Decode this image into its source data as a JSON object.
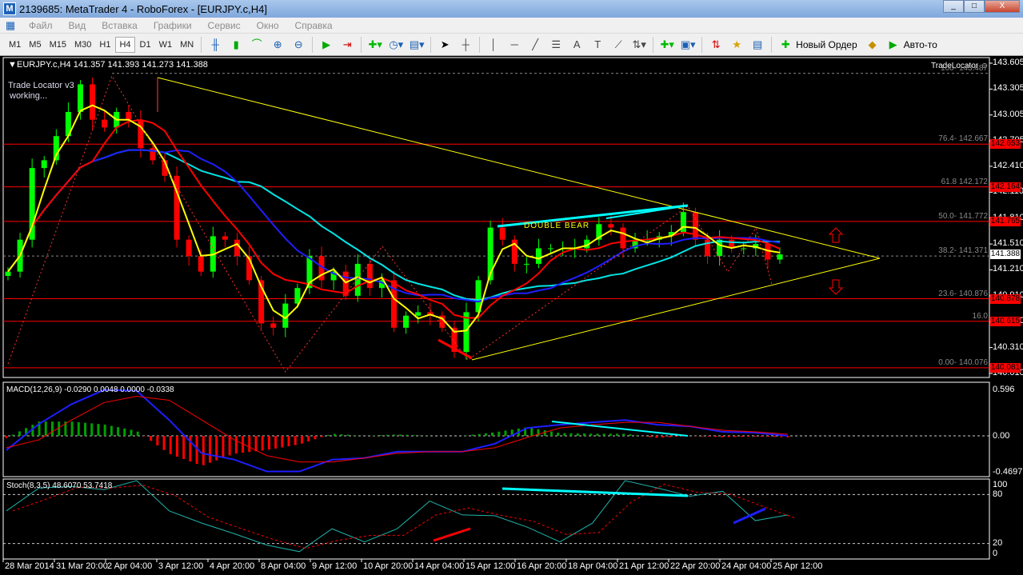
{
  "window": {
    "title": "2139685: MetaTrader 4 - RoboForex - [EURJPY.c,H4]",
    "app_icon": "mt4-logo-icon",
    "min": "_",
    "max": "□",
    "close": "X"
  },
  "menu": [
    "Файл",
    "Вид",
    "Вставка",
    "Графики",
    "Сервис",
    "Окно",
    "Справка"
  ],
  "toolbar": {
    "timeframes": [
      "M1",
      "M5",
      "M15",
      "M30",
      "H1",
      "H4",
      "D1",
      "W1",
      "MN"
    ],
    "active_timeframe": "H4",
    "new_order": "Новый Ордер",
    "autotrading": "Авто-то"
  },
  "chart": {
    "header": "EURJPY.c,H4  141.357 141.393 141.273 141.388",
    "indicator_name": "Trade Locator v3",
    "indicator_status": "working...",
    "tradelocator_label": "TradeLocator ☺",
    "annotation": "DOUBLE BEAR",
    "current_price": "141.388",
    "price_axis": [
      "143.605",
      "143.305",
      "143.005",
      "142.705",
      "142.410",
      "142.110",
      "141.810",
      "141.510",
      "141.210",
      "140.910",
      "140.610",
      "140.310",
      "140.010"
    ],
    "fib_levels": [
      {
        "label": "100- 143.487",
        "price": 143.487,
        "style": "dashed"
      },
      {
        "label": "76.4- 142.667",
        "price": 142.667,
        "style": "red",
        "tag": "142.653"
      },
      {
        "label": "61.8 142.172",
        "price": 142.172,
        "style": "red",
        "tag": "142.164"
      },
      {
        "label": "50.0- 141.772",
        "price": 141.772,
        "style": "red",
        "tag": "141.765"
      },
      {
        "label": "38.2- 141.371",
        "price": 141.371,
        "style": "dashed"
      },
      {
        "label": "23.6- 140.876",
        "price": 140.876,
        "style": "red",
        "tag": "140.878"
      },
      {
        "label": "16.0",
        "price": 140.615,
        "style": "red",
        "tag": "140.615"
      },
      {
        "label": "0.00- 140.076",
        "price": 140.076,
        "style": "red",
        "tag": "140.081"
      }
    ],
    "colors": {
      "bull": "#00ff00",
      "bear": "#ff0000",
      "ma_fast": "#ffff00",
      "ma_mid": "#ff0000",
      "ma_slow": "#1e1eff",
      "ma_long": "#00e5e5",
      "trend": "#ffff00"
    }
  },
  "macd": {
    "label": "MACD(12,26,9) -0.0290 0.0048 0.0000 -0.0338",
    "axis": [
      "0.596",
      "0.00",
      "-0.4697"
    ]
  },
  "stoch": {
    "label": "Stoch(8,3,5) 48.6070 53.7418",
    "axis": [
      "100",
      "80",
      "20",
      "0"
    ]
  },
  "time_axis": [
    "28 Mar 2014",
    "31 Mar 20:00",
    "2 Apr 04:00",
    "3 Apr 12:00",
    "4 Apr 20:00",
    "8 Apr 04:00",
    "9 Apr 12:00",
    "10 Apr 20:00",
    "14 Apr 04:00",
    "15 Apr 12:00",
    "16 Apr 20:00",
    "18 Apr 04:00",
    "21 Apr 12:00",
    "22 Apr 20:00",
    "24 Apr 04:00",
    "25 Apr 12:00"
  ],
  "chart_data": {
    "type": "candlestick",
    "closes": [
      141.19,
      141.56,
      142.39,
      142.48,
      142.76,
      143.04,
      143.36,
      142.95,
      142.86,
      143.04,
      142.95,
      142.62,
      142.48,
      142.3,
      141.56,
      141.37,
      141.19,
      141.6,
      141.56,
      141.37,
      141.09,
      140.59,
      140.54,
      140.82,
      141.0,
      141.37,
      141.09,
      141.19,
      140.91,
      141.28,
      141.0,
      141.09,
      140.54,
      140.68,
      140.72,
      140.68,
      140.54,
      140.26,
      140.72,
      141.09,
      141.7,
      141.56,
      141.28,
      141.28,
      141.46,
      141.46,
      141.46,
      141.46,
      141.56,
      141.74,
      141.7,
      141.46,
      141.56,
      141.56,
      141.6,
      141.65,
      141.88,
      141.56,
      141.37,
      141.56,
      141.46,
      141.46,
      141.51,
      141.33,
      141.39
    ],
    "ylim": [
      140.01,
      143.605
    ],
    "macd_main": [
      -0.18,
      0.15,
      0.4,
      0.58,
      0.57,
      0.2,
      -0.22,
      -0.3,
      -0.45,
      -0.45,
      -0.3,
      -0.28,
      -0.2,
      -0.2,
      -0.2,
      -0.1,
      0.1,
      0.14,
      0.17,
      0.2,
      0.14,
      0.12,
      0.05,
      0.04,
      0.0
    ],
    "macd_signal": [
      -0.15,
      -0.05,
      0.2,
      0.42,
      0.5,
      0.45,
      0.2,
      -0.05,
      -0.25,
      -0.33,
      -0.33,
      -0.28,
      -0.22,
      -0.2,
      -0.2,
      -0.15,
      -0.02,
      0.1,
      0.14,
      0.17,
      0.17,
      0.12,
      0.07,
      0.05,
      0.02
    ],
    "macd_ylim": [
      -0.4697,
      0.596
    ],
    "stoch_main": [
      60,
      88,
      90,
      86,
      97,
      60,
      45,
      32,
      18,
      10,
      38,
      22,
      38,
      72,
      55,
      54,
      40,
      22,
      45,
      97,
      88,
      78,
      84,
      48,
      55
    ],
    "stoch_ylim": [
      0,
      100
    ]
  }
}
